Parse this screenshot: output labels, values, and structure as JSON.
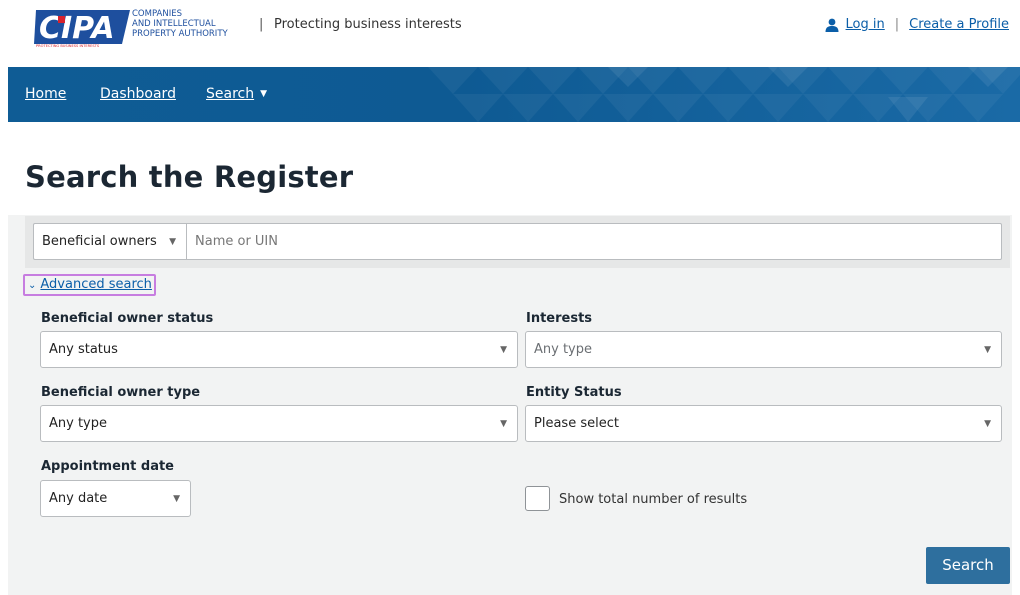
{
  "header": {
    "logo": {
      "mark": "CIPA",
      "line1": "COMPANIES",
      "line2": "AND INTELLECTUAL",
      "line3": "PROPERTY AUTHORITY",
      "motto": "PROTECTING BUSINESS INTERESTS"
    },
    "separator": "|",
    "tagline": "Protecting business interests",
    "login_label": "Log in",
    "links_separator": "|",
    "create_profile_label": "Create a Profile"
  },
  "nav": {
    "items": [
      {
        "label": "Home"
      },
      {
        "label": "Dashboard"
      },
      {
        "label": "Search",
        "caret": "▼"
      }
    ]
  },
  "main": {
    "title": "Search the Register",
    "search": {
      "category_value": "Beneficial owners",
      "category_caret": "▼",
      "placeholder": "Name or UIN"
    },
    "advanced_toggle": {
      "chevron": "⌄",
      "label": "Advanced search"
    },
    "filters": {
      "owner_status": {
        "label": "Beneficial owner status",
        "value": "Any status"
      },
      "interests": {
        "label": "Interests",
        "value": "Any type"
      },
      "owner_type": {
        "label": "Beneficial owner type",
        "value": "Any type"
      },
      "entity_status": {
        "label": "Entity Status",
        "value": "Please select"
      },
      "appointment_date": {
        "label": "Appointment date",
        "value": "Any date"
      },
      "dropdown_caret": "▼"
    },
    "show_total": {
      "label": "Show total number of results",
      "checked": false
    },
    "search_button_label": "Search"
  },
  "colors": {
    "nav_blue": "#0f5c95",
    "link_blue": "#0b5ea8",
    "button_blue": "#2e6f9e",
    "focus_outline": "#c77de0",
    "logo_blue": "#1e4f9e",
    "logo_red": "#d7232e"
  },
  "icons": [
    "user-icon",
    "chevron-down-icon",
    "dropdown-caret-icon"
  ]
}
